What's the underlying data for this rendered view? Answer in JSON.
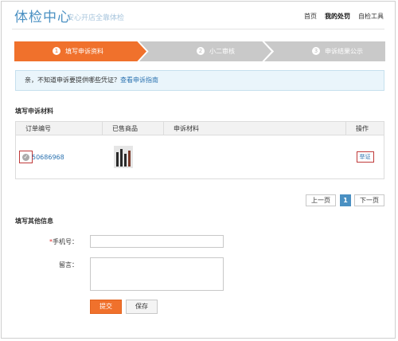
{
  "header": {
    "brand": "体检中心",
    "tagline": "安心开店全靠体检",
    "nav": [
      "首页",
      "我的处罚",
      "自检工具"
    ]
  },
  "steps": [
    {
      "num": "1",
      "label": "填写申诉资料",
      "state": "active"
    },
    {
      "num": "2",
      "label": "小二审核",
      "state": "pending"
    },
    {
      "num": "3",
      "label": "申诉结果公示",
      "state": "pending"
    }
  ],
  "notice": {
    "text": "亲，不知道申诉要提供哪些凭证？",
    "link": "查看申诉指南"
  },
  "materials": {
    "title": "填写申诉材料",
    "columns": [
      "订单编号",
      "已售商品",
      "申诉材料",
      "操作"
    ],
    "rows": [
      {
        "order_no": "50686968",
        "product_image": "product-thumbnail",
        "material": "",
        "action": "举证"
      }
    ]
  },
  "pager": {
    "prev": "上一页",
    "current": "1",
    "next": "下一页"
  },
  "other_info": {
    "title": "填写其他信息",
    "phone_label": "手机号：",
    "phone_required_mark": "*",
    "phone_value": "",
    "message_label": "留言：",
    "message_value": "",
    "submit_label": "提交",
    "save_label": "保存"
  },
  "colors": {
    "accent": "#f0712c",
    "link": "#2b72b0",
    "brand": "#4a90c2",
    "highlight_box": "#c03a3a"
  }
}
